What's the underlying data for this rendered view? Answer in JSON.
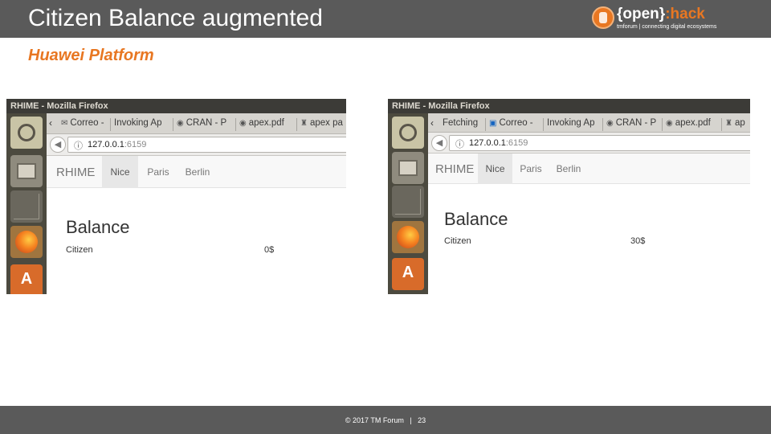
{
  "slide": {
    "title": "Citizen Balance augmented",
    "subtitle": "Huawei Platform",
    "footer": "© 2017 TM Forum   |   23",
    "logo": {
      "open": "{open}",
      "hack": ":hack",
      "tagline": "tmforum | connecting digital ecosystems"
    },
    "colors": {
      "bar": "#5a5a5a",
      "accent": "#e87722"
    }
  },
  "screenshots": [
    {
      "window_title": "RHIME - Mozilla Firefox",
      "tabs": [
        {
          "icon": "mail-icon",
          "label": "Correo -"
        },
        {
          "icon": "",
          "label": "Invoking Ap"
        },
        {
          "icon": "r-icon",
          "label": "CRAN - P"
        },
        {
          "icon": "r-icon",
          "label": "apex.pdf"
        },
        {
          "icon": "doc-icon",
          "label": "apex pa"
        }
      ],
      "url_host": "127.0.0.1",
      "url_port": ":6159",
      "brand": "RHIME",
      "nav": [
        "Nice",
        "Paris",
        "Berlin"
      ],
      "active_nav": "Nice",
      "heading": "Balance",
      "citizen_label": "Citizen",
      "citizen_value": "0$"
    },
    {
      "window_title": "RHIME - Mozilla Firefox",
      "tabs": [
        {
          "icon": "",
          "label": "Fetching"
        },
        {
          "icon": "outlook-icon",
          "label": "Correo -"
        },
        {
          "icon": "",
          "label": "Invoking Ap"
        },
        {
          "icon": "r-icon",
          "label": "CRAN - P"
        },
        {
          "icon": "r-icon",
          "label": "apex.pdf"
        },
        {
          "icon": "doc-icon",
          "label": "ap"
        }
      ],
      "url_host": "127.0.0.1",
      "url_port": ":6159",
      "brand": "RHIME",
      "nav": [
        "Nice",
        "Paris",
        "Berlin"
      ],
      "active_nav": "Nice",
      "heading": "Balance",
      "citizen_label": "Citizen",
      "citizen_value": "30$"
    }
  ]
}
